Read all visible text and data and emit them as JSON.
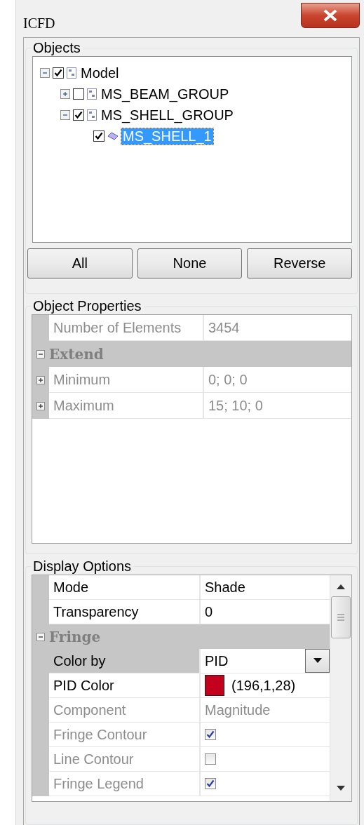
{
  "window": {
    "title": "ICFD"
  },
  "objects": {
    "title": "Objects",
    "tree": [
      {
        "label": "Model",
        "kind": "group",
        "checked": true,
        "expanded": true,
        "selected": false,
        "children": [
          {
            "label": "MS_BEAM_GROUP",
            "kind": "group",
            "checked": false,
            "expanded": false,
            "selected": false
          },
          {
            "label": "MS_SHELL_GROUP",
            "kind": "group",
            "checked": true,
            "expanded": true,
            "selected": false,
            "children": [
              {
                "label": "MS_SHELL_1",
                "kind": "part",
                "checked": true,
                "selected": true
              }
            ]
          }
        ]
      }
    ],
    "buttons": [
      "All",
      "None",
      "Reverse"
    ]
  },
  "object_properties": {
    "title": "Object Properties",
    "rows": [
      {
        "kind": "text",
        "label": "Number of Elements",
        "value": "3454",
        "disabled": true
      },
      {
        "kind": "category",
        "label": "Extend",
        "expanded": true
      },
      {
        "kind": "text",
        "label": "Minimum",
        "value": "0; 0; 0",
        "disabled": true,
        "expanded": false
      },
      {
        "kind": "text",
        "label": "Maximum",
        "value": "15; 10; 0",
        "disabled": true,
        "expanded": false
      }
    ]
  },
  "display_options": {
    "title": "Display Options",
    "rows": [
      {
        "kind": "text",
        "label": "Mode",
        "value": "Shade",
        "disabled": false,
        "selected": false
      },
      {
        "kind": "text",
        "label": "Transparency",
        "value": "0",
        "disabled": false,
        "selected": false
      },
      {
        "kind": "category",
        "label": "Fringe",
        "expanded": true,
        "selected": false
      },
      {
        "kind": "dropdown",
        "label": "Color by",
        "value": "PID",
        "disabled": false,
        "selected": true
      },
      {
        "kind": "color",
        "label": "PID Color",
        "value": "(196,1,28)",
        "color": "#c4011c",
        "disabled": false,
        "selected": false
      },
      {
        "kind": "text",
        "label": "Component",
        "value": "Magnitude",
        "disabled": true,
        "selected": false
      },
      {
        "kind": "checkbox",
        "label": "Fringe Contour",
        "checked": true,
        "disabled": true,
        "selected": false
      },
      {
        "kind": "checkbox",
        "label": "Line Contour",
        "checked": false,
        "disabled": true,
        "selected": false
      },
      {
        "kind": "checkbox",
        "label": "Fringe Legend",
        "checked": true,
        "disabled": true,
        "selected": false
      }
    ]
  }
}
